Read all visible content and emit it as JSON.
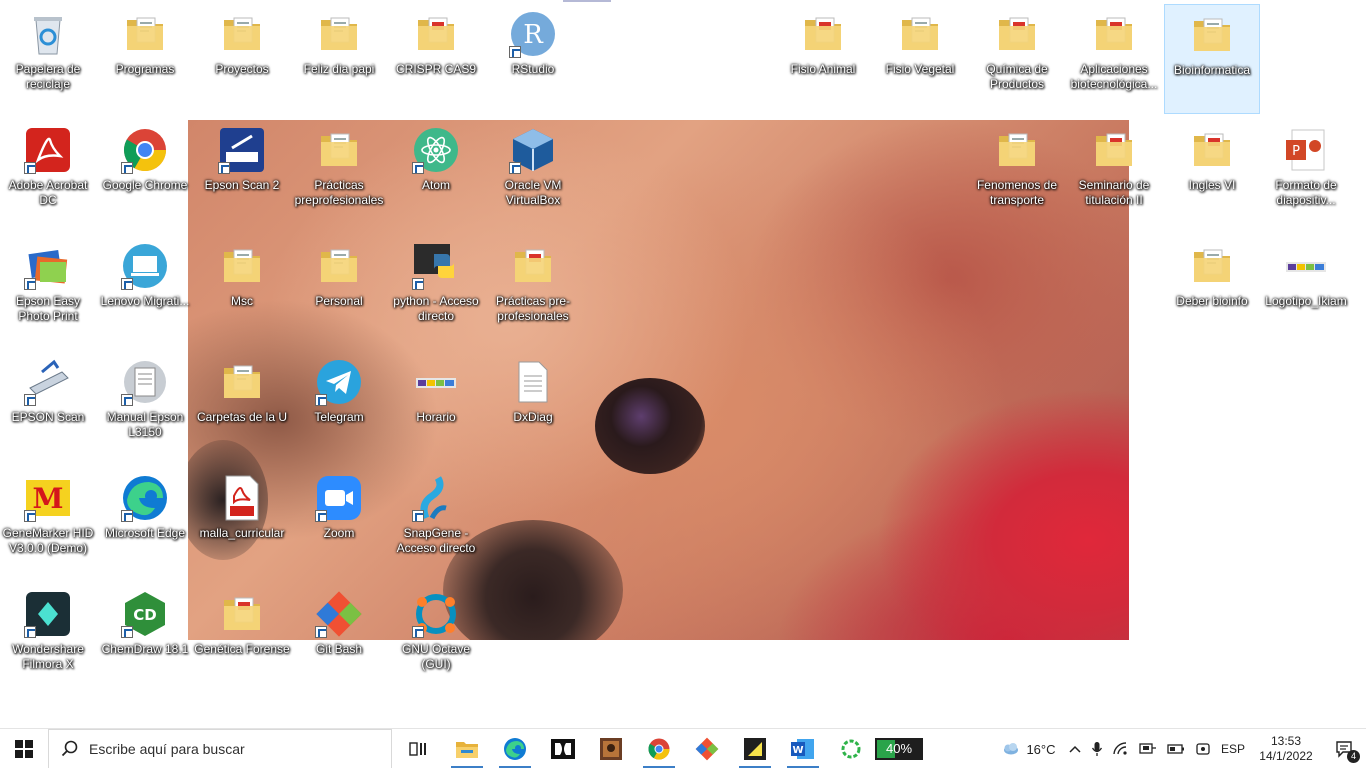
{
  "desktop": {
    "icons": [
      {
        "label": "Papelera de reciclaje",
        "icon": "recycle-bin-icon"
      },
      {
        "label": "Programas",
        "icon": "folder-icon"
      },
      {
        "label": "Proyectos",
        "icon": "folder-icon"
      },
      {
        "label": "Feliz dia papi",
        "icon": "folder-icon"
      },
      {
        "label": "CRISPR CAS9",
        "icon": "pdf-folder-icon"
      },
      {
        "label": "RStudio",
        "icon": "rstudio-icon"
      },
      {
        "label": "Fisio Animal",
        "icon": "pdf-folder-icon"
      },
      {
        "label": "Fisio Vegetal",
        "icon": "folder-icon"
      },
      {
        "label": "Química de Productos",
        "icon": "pdf-folder-icon"
      },
      {
        "label": "Aplicaciones biotecnológica...",
        "icon": "pdf-folder-icon"
      },
      {
        "label": "Bioinformatica",
        "icon": "folder-icon"
      },
      {
        "label": "Adobe Acrobat DC",
        "icon": "acrobat-icon"
      },
      {
        "label": "Google Chrome",
        "icon": "chrome-icon"
      },
      {
        "label": "Epson Scan 2",
        "icon": "epson-scan-icon"
      },
      {
        "label": "Prácticas preprofesionales",
        "icon": "folder-icon"
      },
      {
        "label": "Atom",
        "icon": "atom-icon"
      },
      {
        "label": "Oracle VM VirtualBox",
        "icon": "virtualbox-icon"
      },
      {
        "label": "Fenomenos de transporte",
        "icon": "folder-icon"
      },
      {
        "label": "Seminario de titulación II",
        "icon": "pdf-folder-icon"
      },
      {
        "label": "Ingles VI",
        "icon": "pdf-folder-icon"
      },
      {
        "label": "Formato de diapositiv...",
        "icon": "powerpoint-icon"
      },
      {
        "label": "Epson Easy Photo Print",
        "icon": "epson-photo-icon"
      },
      {
        "label": "Lenovo Migrati...",
        "icon": "lenovo-icon"
      },
      {
        "label": "Msc",
        "icon": "folder-icon"
      },
      {
        "label": "Personal",
        "icon": "folder-icon"
      },
      {
        "label": "python - Acceso directo",
        "icon": "python-icon"
      },
      {
        "label": "Prácticas pre-profesionales",
        "icon": "pdf-folder-icon"
      },
      {
        "label": "Deber bioinfo",
        "icon": "folder-icon"
      },
      {
        "label": "Logotipo_Ikiam",
        "icon": "image-icon"
      },
      {
        "label": "EPSON Scan",
        "icon": "scanner-icon"
      },
      {
        "label": "Manual Epson L3150",
        "icon": "manual-icon"
      },
      {
        "label": "Carpetas de la U",
        "icon": "folder-icon"
      },
      {
        "label": "Telegram",
        "icon": "telegram-icon"
      },
      {
        "label": "Horario",
        "icon": "image-icon"
      },
      {
        "label": "DxDiag",
        "icon": "text-file-icon"
      },
      {
        "label": "GeneMarker HID V3.0.0 (Demo)",
        "icon": "genemarker-icon"
      },
      {
        "label": "Microsoft Edge",
        "icon": "edge-icon"
      },
      {
        "label": "malla_curricular",
        "icon": "pdf-file-icon"
      },
      {
        "label": "Zoom",
        "icon": "zoom-icon"
      },
      {
        "label": "SnapGene - Acceso directo",
        "icon": "snapgene-icon"
      },
      {
        "label": "Wondershare Filmora X",
        "icon": "filmora-icon"
      },
      {
        "label": "ChemDraw 18.1",
        "icon": "chemdraw-icon"
      },
      {
        "label": "Genética Forense",
        "icon": "pdf-folder-icon"
      },
      {
        "label": "Git Bash",
        "icon": "git-icon"
      },
      {
        "label": "GNU Octave (GUI)",
        "icon": "octave-icon"
      }
    ],
    "selected": "Bioinformatica"
  },
  "taskbar": {
    "search_placeholder": "Escribe aquí para buscar",
    "pinned": [
      {
        "icon": "task-view-icon",
        "active": false
      },
      {
        "icon": "file-explorer-icon",
        "active": true
      },
      {
        "icon": "edge-icon",
        "active": true
      },
      {
        "icon": "dolby-icon",
        "active": false
      },
      {
        "icon": "photo-app-icon",
        "active": false
      },
      {
        "icon": "chrome-icon",
        "active": true
      },
      {
        "icon": "git-icon",
        "active": false
      },
      {
        "icon": "sticky-notes-icon",
        "active": true
      },
      {
        "icon": "word-icon",
        "active": true
      },
      {
        "icon": "refresh-app-icon",
        "active": false
      }
    ],
    "battery_percent": 40,
    "battery_label": "40%",
    "weather": "16°C",
    "language": "ESP",
    "time": "13:53",
    "date": "14/1/2022",
    "notifications": "4",
    "colors": {
      "accent": "#3c7fc7",
      "battery_fill": "#2aa44a"
    }
  }
}
